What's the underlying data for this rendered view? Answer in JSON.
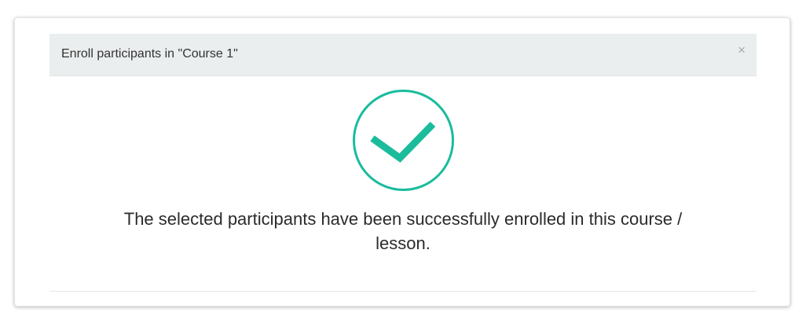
{
  "dialog": {
    "title": "Enroll participants in \"Course 1\"",
    "close_label": "×",
    "message_line1": "The selected participants have been successfully enrolled in this course /",
    "message_line2": "lesson.",
    "icon": "check-circle-icon",
    "accent_color": "#1abc9c"
  }
}
